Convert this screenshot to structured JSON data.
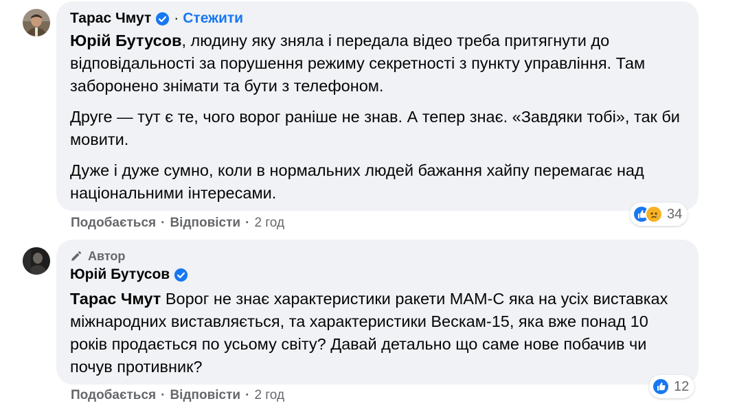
{
  "comment1": {
    "author": "Тарас Чмут",
    "follow_label": "Стежити",
    "mention": "Юрій Бутусов",
    "p1_rest": ", людину яку зняла і передала відео треба притягнути до відповідальності за порушення режиму секретності з пункту управління. Там заборонено знімати та бути з телефоном.",
    "p2": "Друге — тут є те, чого ворог раніше не знав. А тепер знає. «Завдяки тобі», так би мовити.",
    "p3": "Дуже і дуже сумно, коли в нормальних людей бажання хайпу перемагає над національними інтересами.",
    "actions": {
      "like": "Подобається",
      "reply": "Відповісти",
      "time": "2 год"
    },
    "reactions": {
      "icons": [
        "like-icon",
        "sad-icon"
      ],
      "count": "34"
    }
  },
  "comment2": {
    "badge": "Автор",
    "author": "Юрій Бутусов",
    "mention": "Тарас Чмут",
    "text_rest": " Ворог не знає характеристики ракети МАМ-С яка на усіх виставках міжнародних виставляється, та характеристики Вескам-15, яка вже понад 10 років продається по усьому світу? Давай детально що саме нове побачив чи почув противник?",
    "actions": {
      "like": "Подобається",
      "reply": "Відповісти",
      "time": "2 год"
    },
    "reactions": {
      "icons": [
        "like-icon"
      ],
      "count": "12"
    }
  },
  "colors": {
    "bubble": "#f0f2f5",
    "link_blue": "#1877f2",
    "secondary_text": "#65676b",
    "text": "#050505"
  }
}
